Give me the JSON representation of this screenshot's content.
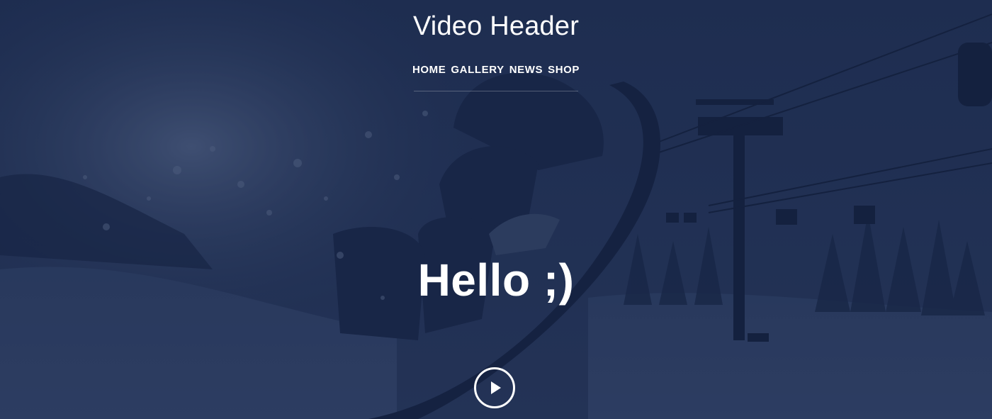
{
  "header": {
    "title": "Video Header"
  },
  "nav": {
    "items": [
      "HOME",
      "GALLERY",
      "NEWS",
      "SHOP"
    ]
  },
  "hero": {
    "headline": "Hello ;)",
    "play_icon": "play-icon"
  },
  "colors": {
    "overlay": "#1f2d4a",
    "text": "#ffffff"
  }
}
